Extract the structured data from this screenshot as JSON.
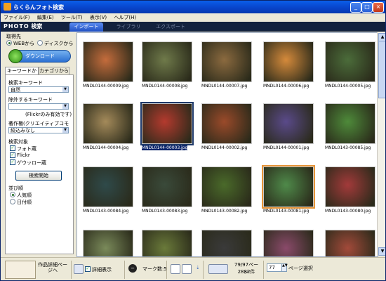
{
  "window": {
    "title": "らくらんフォト検索"
  },
  "menu": [
    "ファイル(F)",
    "編集(E)",
    "ツール(T)",
    "表示(V)",
    "ヘルプ(H)"
  ],
  "header": {
    "logo_text": "PHOTO",
    "logo_suffix": "検索",
    "tabs": [
      "インポート",
      "ライブラリ",
      "エクスポート"
    ],
    "active_tab": 0
  },
  "left": {
    "source_label": "取得先",
    "source_web": "WEBから",
    "source_disk": "ディスクから",
    "download_label": "ダウンロード",
    "tabs": [
      "キーワードから",
      "カテゴリから"
    ],
    "keyword_label": "検索キーワード",
    "keyword_value": "自然",
    "exclude_label": "除外するキーワード",
    "exclude_value": "",
    "flickr_note": "(Flickrのみ有効です)",
    "copyright_label": "著作権(クリエイティブコモンズ)",
    "copyright_value": "絞込みなし",
    "target_label": "検索対象",
    "targets": [
      "フォト蔵",
      "Flickr",
      "ゲウッロー蔵"
    ],
    "search_button": "検索開始",
    "order_label": "並び順",
    "orders": [
      "人気順",
      "日付順"
    ]
  },
  "thumbs": [
    {
      "file": "MNDL0144-00009.jpg",
      "color": "#c46c3c"
    },
    {
      "file": "MNDL0144-00008.jpg",
      "color": "#6f7a4a"
    },
    {
      "file": "MNDL0144-00007.jpg",
      "color": "#8b6a3f"
    },
    {
      "file": "MNDL0144-00006.jpg",
      "color": "#d58a3b"
    },
    {
      "file": "MNDL0144-00005.jpg",
      "color": "#4b6c3a"
    },
    {
      "file": "MNDL0144-00004.jpg",
      "color": "#a48a5a"
    },
    {
      "file": "MNDL0144-00003.jpg",
      "color": "#b43a2e"
    },
    {
      "file": "MNDL0144-00002.jpg",
      "color": "#9a4a2a"
    },
    {
      "file": "MNDL0144-00001.jpg",
      "color": "#5a4a8a"
    },
    {
      "file": "MNDL0143-00085.jpg",
      "color": "#4e8a3a"
    },
    {
      "file": "MNDL0143-00084.jpg",
      "color": "#2f4a4a"
    },
    {
      "file": "MNDL0143-00083.jpg",
      "color": "#3a4a3a"
    },
    {
      "file": "MNDL0143-00082.jpg",
      "color": "#4a6a2a"
    },
    {
      "file": "MNDL0143-00081.jpg",
      "color": "#4f8a4a"
    },
    {
      "file": "MNDL0143-00080.jpg",
      "color": "#a23a3a"
    },
    {
      "file": "",
      "color": "#7a8a5a"
    },
    {
      "file": "",
      "color": "#6a7a3a"
    },
    {
      "file": "",
      "color": "#3a3a3a"
    },
    {
      "file": "",
      "color": "#8a4a6a"
    },
    {
      "file": "",
      "color": "#a24a3a"
    }
  ],
  "selected_index": 6,
  "highlight_index": 13,
  "bottom": {
    "work_label": "作品詳細ページへ",
    "detail_label": "詳細表示",
    "mark_count": "マーク数:5",
    "page_info": "79/97ページ",
    "count_info": "2882件",
    "page_input": "77",
    "page_select": "ページ選択"
  }
}
